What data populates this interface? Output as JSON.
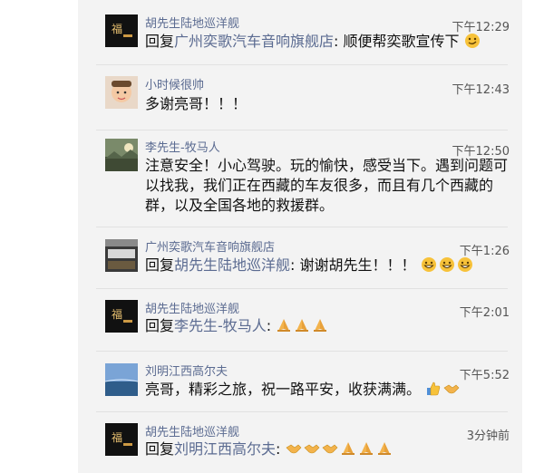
{
  "comments": [
    {
      "author": "胡先生陆地巡洋舰",
      "time": "下午12:29",
      "reply_prefix": "回复",
      "reply_to": "广州奕歌汽车音响旗舰店",
      "text": ": 顺便帮奕歌宣传下",
      "emojis": [
        "smirk-emoji"
      ]
    },
    {
      "author": "小时候很帅",
      "time": "下午12:43",
      "text": "多谢亮哥！！！"
    },
    {
      "author": "李先生-牧马人",
      "time": "下午12:50",
      "text": "注意安全！小心驾驶。玩的愉快，感受当下。遇到问题可以找我，我们正在西藏的车友很多，而且有几个西藏的群，以及全国各地的救援群。"
    },
    {
      "author": "广州奕歌汽车音响旗舰店",
      "time": "下午1:26",
      "reply_prefix": "回复",
      "reply_to": "胡先生陆地巡洋舰",
      "text": ": 谢谢胡先生！！！",
      "emojis": [
        "grin-emoji",
        "grin-emoji",
        "grin-emoji"
      ]
    },
    {
      "author": "胡先生陆地巡洋舰",
      "time": "下午2:01",
      "reply_prefix": "回复",
      "reply_to": "李先生-牧马人",
      "text": ":",
      "emojis": [
        "pray-emoji",
        "pray-emoji",
        "pray-emoji"
      ]
    },
    {
      "author": "刘明江西高尔夫",
      "time": "下午5:52",
      "text": "亮哥，精彩之旅，祝一路平安，收获满满。",
      "emojis": [
        "thumbs-up-emoji",
        "handshake-emoji"
      ]
    },
    {
      "author": "胡先生陆地巡洋舰",
      "time": "3分钟前",
      "reply_prefix": "回复",
      "reply_to": "刘明江西高尔夫",
      "text": ":",
      "emojis": [
        "handshake-emoji",
        "handshake-emoji",
        "handshake-emoji",
        "pray-emoji",
        "pray-emoji",
        "pray-emoji"
      ]
    }
  ],
  "colors": {
    "name": "#5b6b91",
    "panel_bg": "#f3f3f3",
    "separator": "#e1e1e1"
  }
}
